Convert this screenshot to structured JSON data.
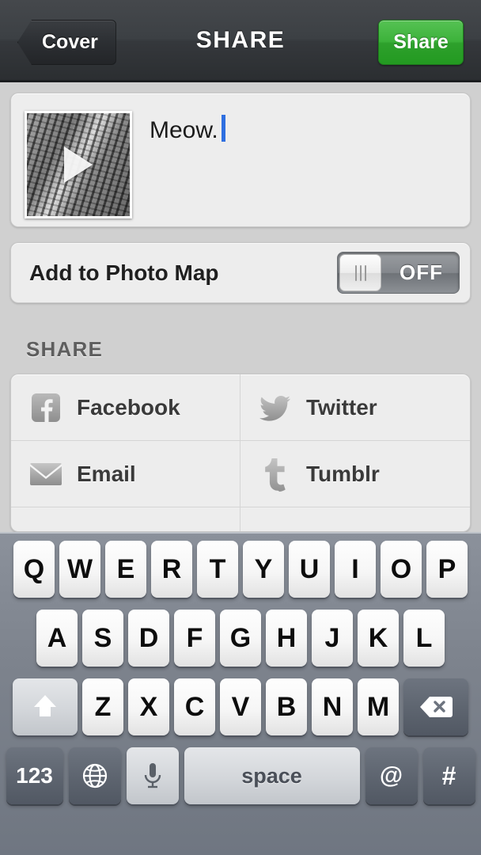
{
  "navbar": {
    "back_label": "Cover",
    "title": "SHARE",
    "share_label": "Share",
    "share_button_color": "#3cb23a",
    "bar_color": "#35383c"
  },
  "caption": {
    "text": "Meow.",
    "media_type": "video-thumbnail",
    "caret_color": "#2f6fe0"
  },
  "photo_map": {
    "label": "Add to Photo Map",
    "toggle_state": "OFF"
  },
  "share_section": {
    "header": "SHARE",
    "services": [
      {
        "label": "Facebook",
        "icon": "facebook-icon"
      },
      {
        "label": "Twitter",
        "icon": "twitter-icon"
      },
      {
        "label": "Email",
        "icon": "email-icon"
      },
      {
        "label": "Tumblr",
        "icon": "tumblr-icon"
      }
    ]
  },
  "keyboard": {
    "row1": [
      "Q",
      "W",
      "E",
      "R",
      "T",
      "Y",
      "U",
      "I",
      "O",
      "P"
    ],
    "row2": [
      "A",
      "S",
      "D",
      "F",
      "G",
      "H",
      "J",
      "K",
      "L"
    ],
    "row3": [
      "Z",
      "X",
      "C",
      "V",
      "B",
      "N",
      "M"
    ],
    "shift_key": "shift-icon",
    "delete_key": "backspace-icon",
    "numbers_key": "123",
    "globe_key": "globe-icon",
    "mic_key": "microphone-icon",
    "space_key": "space",
    "at_key": "@",
    "hash_key": "#"
  }
}
